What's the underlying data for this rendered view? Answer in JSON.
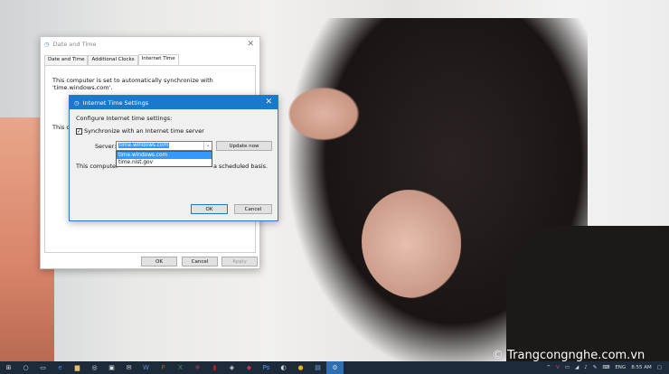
{
  "date_time_dialog": {
    "title": "Date and Time",
    "tabs": [
      "Date and Time",
      "Additional Clocks",
      "Internet Time"
    ],
    "active_tab": "Internet Time",
    "sync_text_1": "This computer is set to automatically synchronize with",
    "sync_text_2": "'time.windows.com'.",
    "partial_text": "This co",
    "ok": "OK",
    "cancel": "Cancel",
    "apply": "Apply"
  },
  "internet_time_dialog": {
    "title": "Internet Time Settings",
    "heading": "Configure Internet time settings:",
    "sync_checkbox": "Synchronize with an Internet time server",
    "sync_checked": true,
    "server_label": "Server:",
    "server_value": "time.windows.com",
    "options": [
      "time.windows.com",
      "time.nist.gov"
    ],
    "update_now": "Update now",
    "info_left": "This computer",
    "info_right": "a scheduled basis.",
    "ok": "OK",
    "cancel": "Cancel"
  },
  "watermark": "© Trangcongnghe.com.vn",
  "taskbar": {
    "icons": [
      "windows-start",
      "cortana",
      "task-view",
      "edge",
      "file-explorer",
      "media",
      "store",
      "mail",
      "word",
      "powerpoint",
      "excel",
      "app",
      "app",
      "app",
      "app",
      "photoshop",
      "app",
      "chrome",
      "app",
      "settings"
    ],
    "tray": {
      "language": "ENG",
      "time": "8:55 AM"
    },
    "colors": {
      "taskbar": "#1d2a3a",
      "accent": "#1979ca"
    }
  }
}
